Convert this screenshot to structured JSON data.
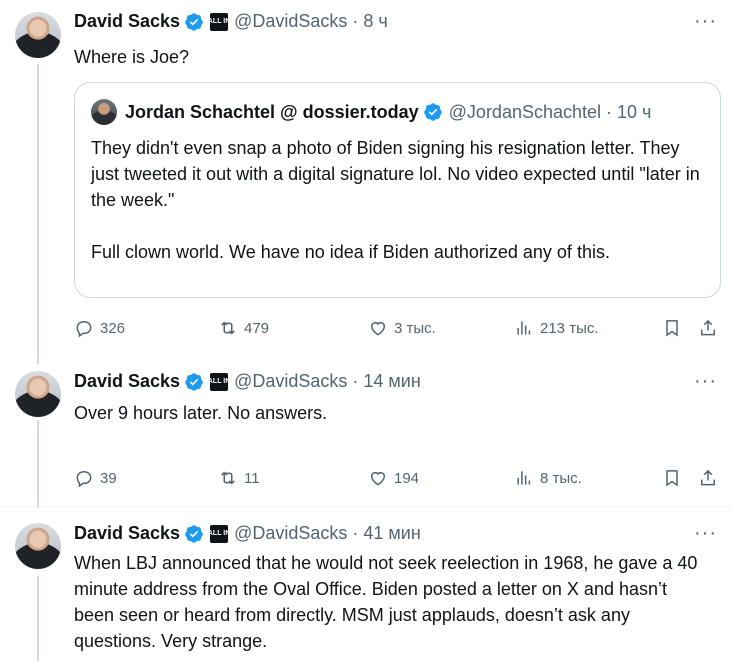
{
  "tweets": [
    {
      "name": "David Sacks",
      "affiliation": "ALL IN",
      "handle": "@DavidSacks",
      "time": "8 ч",
      "text": "Where is Joe?",
      "quote": {
        "name": "Jordan Schachtel @ dossier.today",
        "handle": "@JordanSchachtel",
        "time": "10 ч",
        "paragraph1": "They didn't even snap a photo of Biden signing his resignation letter. They just tweeted it out with a digital signature lol. No video expected until \"later in the week.\"",
        "paragraph2": "Full clown world. We have no idea if Biden authorized any of this."
      },
      "stats": {
        "replies": "326",
        "reposts": "479",
        "likes": "3 тыс.",
        "views": "213 тыс."
      }
    },
    {
      "name": "David Sacks",
      "affiliation": "ALL IN",
      "handle": "@DavidSacks",
      "time": "14 мин",
      "text": "Over 9 hours later. No answers.",
      "stats": {
        "replies": "39",
        "reposts": "11",
        "likes": "194",
        "views": "8 тыс."
      }
    },
    {
      "name": "David Sacks",
      "affiliation": "ALL IN",
      "handle": "@DavidSacks",
      "time": "41 мин",
      "text": "When LBJ announced that he would not seek reelection in 1968, he gave a 40 minute address from the Oval Office. Biden posted a letter on X and hasn’t been seen or heard from directly. MSM just applauds, doesn’t ask any questions. Very strange."
    }
  ],
  "icons": {
    "more": "more-icon",
    "reply": "reply-icon",
    "repost": "repost-icon",
    "like": "like-icon",
    "views": "views-icon",
    "bookmark": "bookmark-icon",
    "share": "share-icon",
    "verified": "verified-badge-icon"
  },
  "colors": {
    "verified": "#1d9bf0",
    "muted": "#536471",
    "text": "#0f1419",
    "border": "#cfd9de"
  }
}
